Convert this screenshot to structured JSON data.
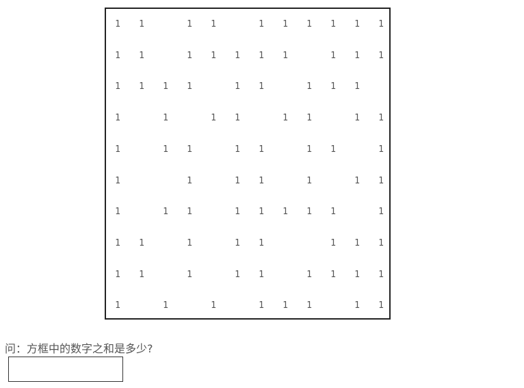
{
  "grid": {
    "rows": [
      [
        "1",
        "1",
        "",
        "1",
        "1",
        "",
        "1",
        "1",
        "1",
        "1",
        "1",
        "1"
      ],
      [
        "1",
        "1",
        "",
        "1",
        "1",
        "1",
        "1",
        "1",
        "",
        "1",
        "1",
        "1"
      ],
      [
        "1",
        "1",
        "1",
        "1",
        "",
        "1",
        "1",
        "",
        "1",
        "1",
        "1",
        ""
      ],
      [
        "1",
        "",
        "1",
        "",
        "1",
        "1",
        "",
        "1",
        "1",
        "",
        "1",
        "1"
      ],
      [
        "1",
        "",
        "1",
        "1",
        "",
        "1",
        "1",
        "",
        "1",
        "1",
        "",
        "1"
      ],
      [
        "1",
        "",
        "",
        "1",
        "",
        "1",
        "1",
        "",
        "1",
        "",
        "1",
        "1"
      ],
      [
        "1",
        "",
        "1",
        "1",
        "",
        "1",
        "1",
        "1",
        "1",
        "1",
        "",
        "1"
      ],
      [
        "1",
        "1",
        "",
        "1",
        "",
        "1",
        "1",
        "",
        "",
        "1",
        "1",
        "1"
      ],
      [
        "1",
        "1",
        "",
        "1",
        "",
        "1",
        "1",
        "",
        "1",
        "1",
        "1",
        "1"
      ],
      [
        "1",
        "",
        "1",
        "",
        "1",
        "",
        "1",
        "1",
        "1",
        "",
        "1",
        "1"
      ]
    ]
  },
  "question": {
    "text": "问：方框中的数字之和是多少?"
  },
  "answer": {
    "value": ""
  }
}
